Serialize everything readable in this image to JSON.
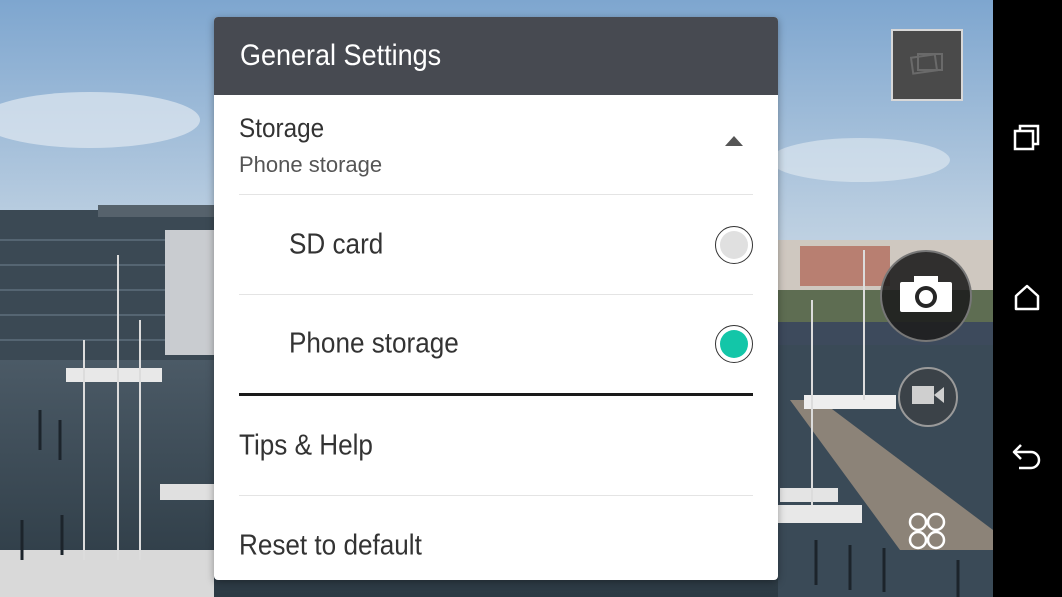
{
  "dialog": {
    "title": "General Settings",
    "storage": {
      "title": "Storage",
      "selected_value": "Phone storage",
      "expanded": true,
      "toggle_icon": "chevron-up-icon"
    },
    "storage_options": [
      {
        "label": "SD card",
        "selected": false
      },
      {
        "label": "Phone storage",
        "selected": true
      }
    ],
    "menu_items": [
      {
        "label": "Tips & Help"
      },
      {
        "label": "Reset to default"
      }
    ]
  },
  "camera_controls": {
    "gallery_thumbnail_icon": "gallery-icon",
    "shutter_icon": "camera-icon",
    "video_icon": "video-camera-icon",
    "modes_icon": "camera-modes-icon"
  },
  "nav_bar": {
    "recents_icon": "recent-apps-icon",
    "home_icon": "home-icon",
    "back_icon": "back-icon"
  },
  "colors": {
    "header_bg": "#474a51",
    "accent": "#13c6a8"
  }
}
